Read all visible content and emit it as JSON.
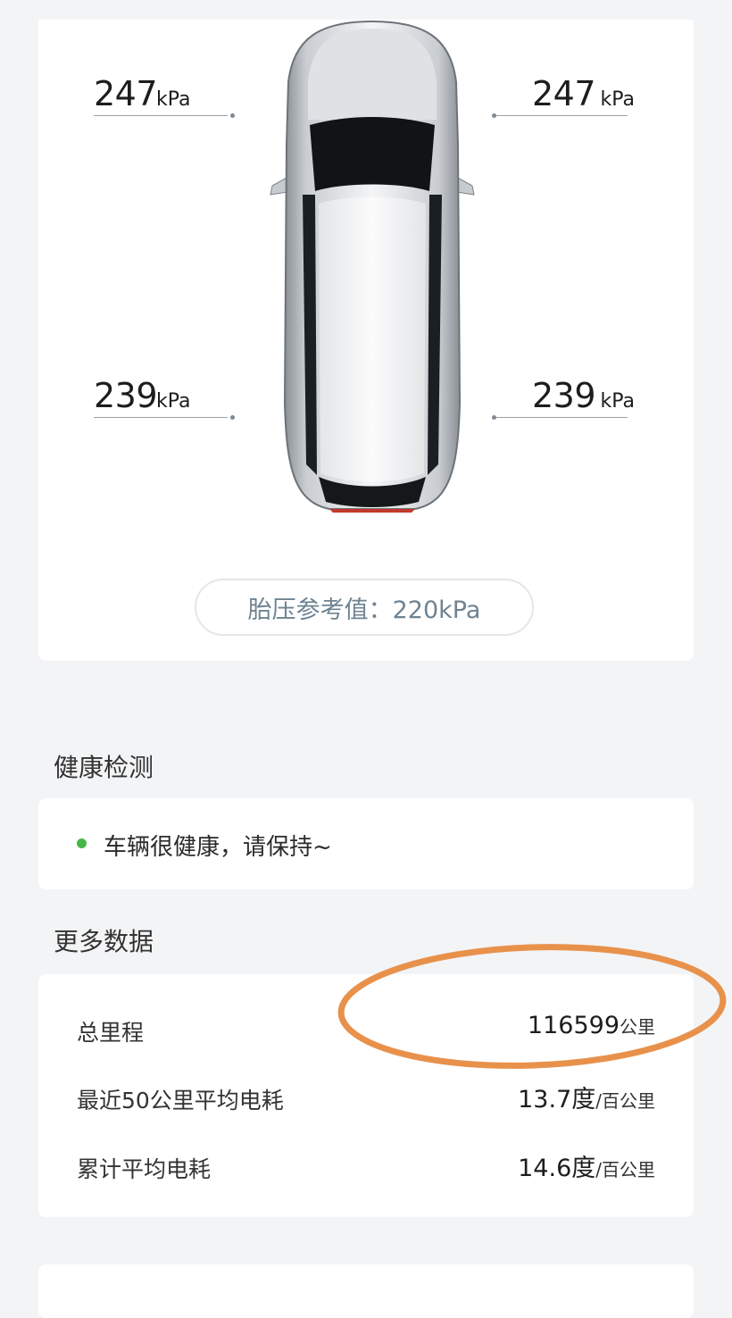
{
  "tires": {
    "front_left": {
      "value": "247",
      "unit": "kPa"
    },
    "front_right": {
      "value": "247",
      "unit": "kPa"
    },
    "rear_left": {
      "value": "239",
      "unit": "kPa"
    },
    "rear_right": {
      "value": "239",
      "unit": "kPa"
    }
  },
  "reference": {
    "label": "胎压参考值：220kPa"
  },
  "health": {
    "title": "健康检测",
    "status": "车辆很健康，请保持~",
    "status_color": "#46b649"
  },
  "more_data": {
    "title": "更多数据",
    "rows": [
      {
        "label": "总里程",
        "value": "116599",
        "unit": "公里"
      },
      {
        "label": "最近50公里平均电耗",
        "value": "13.7度",
        "unit": "/百公里"
      },
      {
        "label": "累计平均电耗",
        "value": "14.6度",
        "unit": "/百公里"
      }
    ]
  },
  "annotation": {
    "color": "#e8914b",
    "shape": "ellipse"
  },
  "colors": {
    "background": "#f3f4f6",
    "card": "#ffffff",
    "reference_text": "#6f8391"
  }
}
